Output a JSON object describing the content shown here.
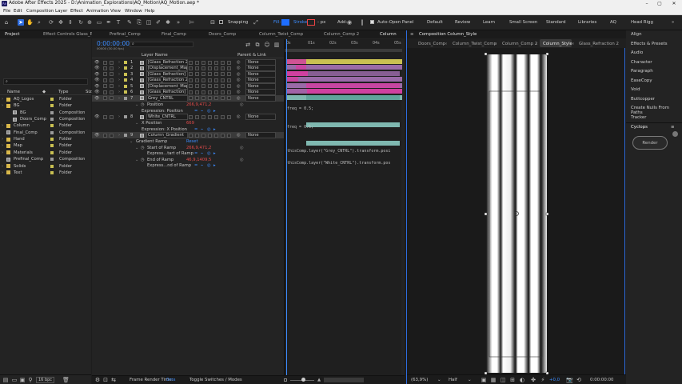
{
  "window": {
    "title": "Adobe After Effects 2025 - D:\\Animation_Explorations\\AQ_Motion\\AQ_Motion.aep *",
    "app_badge": "Ae"
  },
  "menu": [
    "File",
    "Edit",
    "Composition",
    "Layer",
    "Effect",
    "Animation",
    "View",
    "Window",
    "Help"
  ],
  "toolbar": {
    "snapping": "Snapping",
    "fill": "Fill:",
    "stroke": "Stroke:",
    "stroke_px": "- px",
    "add": "Add:",
    "auto_open": "Auto-Open Panel",
    "workspaces": [
      "Default",
      "Review",
      "Learn",
      "Small Screen",
      "Standard",
      "Libraries",
      "AQ",
      "Head Rigg"
    ]
  },
  "project": {
    "tab": "Project",
    "effect_controls_tab": "Effect Controls Glass_R",
    "search_placeholder": "",
    "col_name": "Name",
    "col_type": "Type",
    "col_size": "Siz",
    "items": [
      {
        "name": "AQ_Logos",
        "type": "Folder",
        "indent": 0,
        "kind": "folder"
      },
      {
        "name": "BG",
        "type": "Folder",
        "indent": 0,
        "kind": "folder"
      },
      {
        "name": "BG",
        "type": "Composition",
        "indent": 1,
        "kind": "comp"
      },
      {
        "name": "Doors_Comp",
        "type": "Composition",
        "indent": 1,
        "kind": "comp"
      },
      {
        "name": "Column",
        "type": "Folder",
        "indent": 0,
        "kind": "folder"
      },
      {
        "name": "Final_Comp",
        "type": "Composition",
        "indent": 0,
        "kind": "comp"
      },
      {
        "name": "Hand",
        "type": "Folder",
        "indent": 0,
        "kind": "folder"
      },
      {
        "name": "Map",
        "type": "Folder",
        "indent": 0,
        "kind": "folder"
      },
      {
        "name": "Materials",
        "type": "Folder",
        "indent": 0,
        "kind": "folder"
      },
      {
        "name": "Prefinal_Comp",
        "type": "Composition",
        "indent": 0,
        "kind": "comp"
      },
      {
        "name": "Solids",
        "type": "Folder",
        "indent": 0,
        "kind": "folder"
      },
      {
        "name": "Text",
        "type": "Folder",
        "indent": 0,
        "kind": "folder"
      }
    ],
    "bpc": "16 bpc"
  },
  "timeline": {
    "tabs": [
      "Prefinal_Comp",
      "Final_Comp",
      "Doors_Comp",
      "Column_Twist_Comp",
      "Column_Comp 2",
      "Column"
    ],
    "timecode": "0:00:00:00",
    "fps": "00000 (30.00 fps)",
    "col_layer_name": "Layer Name",
    "col_parent": "Parent & Link",
    "ruler": [
      "0s",
      "01s",
      "02s",
      "03s",
      "04s",
      "05s"
    ],
    "layers": [
      {
        "num": "1",
        "name": "[Glass_Refraction 2]",
        "parent": "None",
        "color": "#c9c052"
      },
      {
        "num": "2",
        "name": "[Displacement_Map 2]",
        "parent": "None",
        "color": "#c9c052"
      },
      {
        "num": "3",
        "name": "[Glass_Refraction]",
        "parent": "None",
        "color": "#c9c052"
      },
      {
        "num": "4",
        "name": "[Glass_Refraction 2]",
        "parent": "None",
        "color": "#c9c052"
      },
      {
        "num": "5",
        "name": "[Displacement_Map]",
        "parent": "None",
        "color": "#c9c052"
      },
      {
        "num": "6",
        "name": "[Glass_Refraction]",
        "parent": "None",
        "color": "#c9c052"
      },
      {
        "num": "7",
        "name": "Grey_CNTRL",
        "parent": "None",
        "color": "#9b9b9b"
      }
    ],
    "position_label": "Position",
    "position_value": "266,9,471,2",
    "expr_position": "Expression: Position",
    "layer8": {
      "num": "8",
      "name": "White_CNTRL",
      "parent": "None"
    },
    "xpos_label": "X Position",
    "xpos_value": "669",
    "expr_xpos": "Expression: X Position",
    "layer9": {
      "num": "9",
      "name": "Column_Gradient",
      "parent": "None"
    },
    "gradient_ramp": "Gradient Ramp",
    "reset": "Reset",
    "start_ramp": "Start of Ramp",
    "start_value": "266,9,471,2",
    "start_expr": "Express...tart of Ramp",
    "end_ramp": "End of Ramp",
    "end_value": "46,9,1409,5",
    "end_expr": "Express...nd of Ramp",
    "code_freq1": "freq = 0.5;",
    "code_freq2": "freq = 0.5;",
    "code_start": "thisComp.layer(\"Grey_CNTRL\").transform.posi",
    "code_end": "thisComp.layer(\"White_CNTRL\").transform.pos",
    "frame_render": "Frame Render Time:",
    "frame_ms": "0ms",
    "toggle": "Toggle Switches / Modes"
  },
  "viewer": {
    "tab": "Composition Column_Style",
    "subtabs": [
      "Doors_Comp",
      "Column_Twist_Comp",
      "Column_Comp 2",
      "Column_Style",
      "Glass_Refraction 2"
    ],
    "zoom": "(63,9%)",
    "quality": "Half",
    "exposure": "+0,0",
    "timecode": "0:00:00:00"
  },
  "right_panel": {
    "items": [
      "Align",
      "Effects & Presets",
      "Audio",
      "Character",
      "Paragraph",
      "EaseCopy",
      "Void",
      "Buttcopper",
      "Create Nulls From Paths",
      "Tracker"
    ],
    "cyclops": "Cyclops",
    "render": "Render"
  }
}
